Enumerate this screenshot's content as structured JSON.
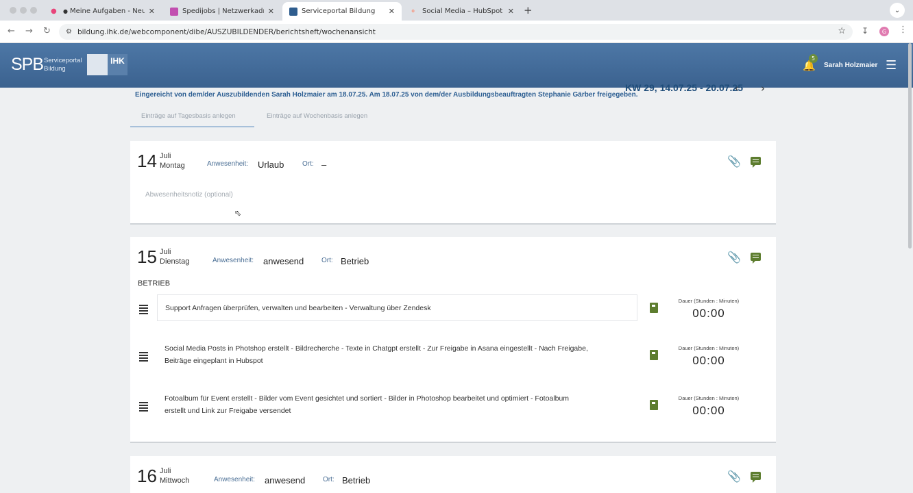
{
  "browser": {
    "tabs": [
      {
        "label": "Meine Aufgaben - Neuer Ja",
        "favicon_color": "#e8447a",
        "modified": true
      },
      {
        "label": "Spedijobs | Netzwerkadminis",
        "favicon_color": "#c24fb0"
      },
      {
        "label": "Serviceportal Bildung",
        "favicon_color": "#2f5d8e",
        "active": true
      },
      {
        "label": "Social Media – HubSpot",
        "favicon_color": "#ff7a59"
      }
    ],
    "url": "bildung.ihk.de/webcomponent/dibe/AUSZUBILDENDER/berichtsheft/wochenansicht",
    "profile_initial": "G"
  },
  "header": {
    "logo": "SPB",
    "portal_name_line1": "Serviceportal",
    "portal_name_line2": "Bildung",
    "ihk_logo": "IHK",
    "notification_count": "5",
    "user_name": "Sarah Holzmaier",
    "brand_color": "#4571a0",
    "accent_green": "#5d7d2f"
  },
  "week": {
    "label": "KW 29, 14.07.25 - 20.07.25",
    "submitted_text": "Eingereicht von dem/der Auszubildenden Sarah Holzmaier am 18.07.25. Am 18.07.25 von dem/der Ausbildungsbeauftragten Stephanie Gärber freigegeben."
  },
  "subtabs": {
    "daily": "Einträge auf Tagesbasis anlegen",
    "weekly": "Einträge auf Wochenbasis anlegen"
  },
  "labels": {
    "attendance": "Anwesenheit:",
    "location": "Ort:",
    "duration": "Dauer (Stunden : Minuten)"
  },
  "days": [
    {
      "day": "14",
      "month": "Juli",
      "weekday": "Montag",
      "attendance": "Urlaub",
      "location": "–",
      "note_placeholder": "Abwesenheitsnotiz (optional)"
    },
    {
      "day": "15",
      "month": "Juli",
      "weekday": "Dienstag",
      "attendance": "anwesend",
      "location": "Betrieb",
      "section": "BETRIEB",
      "entries": [
        {
          "line1": "Support Anfragen überprüfen, verwalten und bearbeiten - Verwaltung über Zendesk",
          "line2": "",
          "duration": "00:00"
        },
        {
          "line1": "Social Media Posts in Photshop erstellt - Bildrecherche - Texte in Chatgpt erstellt - Zur Freigabe in Asana eingestellt - Nach Freigabe,",
          "line2": "Beiträge eingeplant in Hubspot",
          "duration": "00:00"
        },
        {
          "line1": "Fotoalbum für Event erstellt - Bilder vom Event gesichtet und sortiert - Bilder in Photoshop bearbeitet und optimiert - Fotoalbum",
          "line2": "erstellt und Link zur Freigabe versendet",
          "duration": "00:00"
        }
      ]
    },
    {
      "day": "16",
      "month": "Juli",
      "weekday": "Mittwoch",
      "attendance": "anwesend",
      "location": "Betrieb"
    }
  ]
}
